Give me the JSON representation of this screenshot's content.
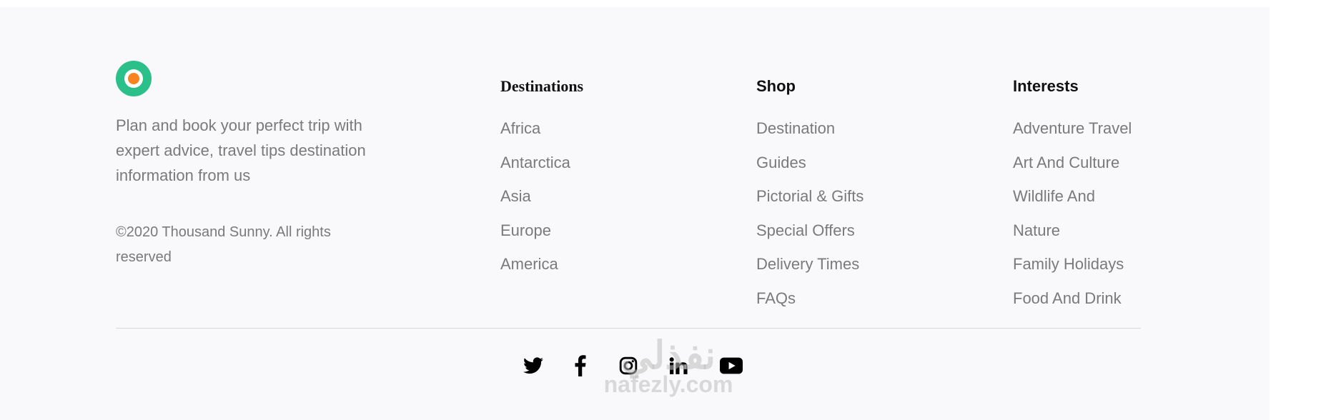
{
  "brand": {
    "logo_icon": "brand-logo-icon",
    "colors": {
      "ring": "#2bbf8a",
      "dot": "#f7841f",
      "background": "#f9f8fb",
      "text_muted": "#7a7a7a"
    },
    "tagline": "Plan and book your perfect trip with expert advice, travel tips destination information from us",
    "copyright": "©2020 Thousand Sunny. All rights reserved"
  },
  "columns": {
    "destinations": {
      "title": "Destinations",
      "links": [
        "Africa",
        "Antarctica",
        "Asia",
        "Europe",
        "America"
      ]
    },
    "shop": {
      "title": "Shop",
      "links": [
        "Destination",
        "Guides",
        "Pictorial & Gifts",
        "Special Offers",
        "Delivery Times",
        "FAQs"
      ]
    },
    "interests": {
      "title": "Interests",
      "links": [
        "Adventure Travel",
        "Art And Culture",
        "Wildlife And",
        "Nature",
        "Family Holidays",
        "Food And Drink"
      ]
    }
  },
  "social": [
    "twitter-icon",
    "facebook-icon",
    "instagram-icon",
    "linkedin-icon",
    "youtube-icon"
  ],
  "watermark": {
    "arabic": "نفذلي",
    "latin": "nafezly.com"
  }
}
